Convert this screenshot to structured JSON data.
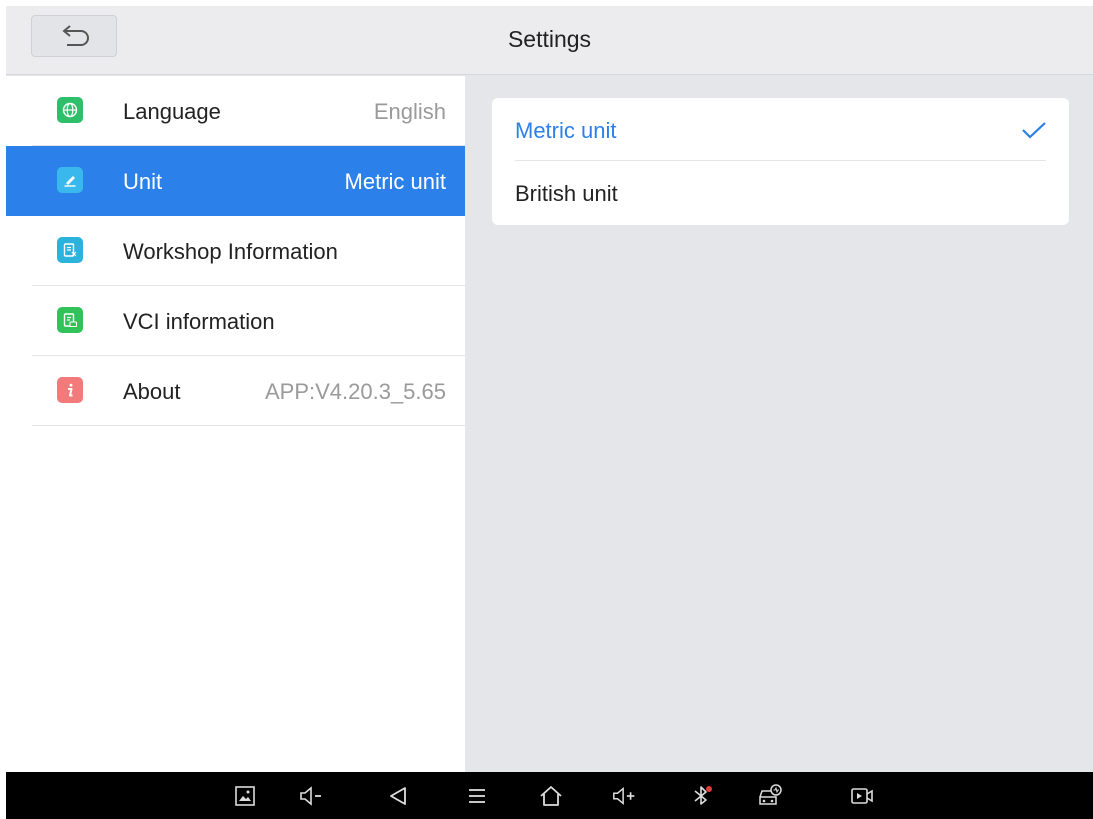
{
  "header": {
    "title": "Settings"
  },
  "sidebar": {
    "items": [
      {
        "label": "Language",
        "value": "English",
        "icon": "globe-icon",
        "color": "#2fbf6a"
      },
      {
        "label": "Unit",
        "value": "Metric unit",
        "icon": "ruler-pencil-icon",
        "color": "#39b8ee",
        "selected": true
      },
      {
        "label": "Workshop Information",
        "value": "",
        "icon": "document-edit-icon",
        "color": "#2bb3dc"
      },
      {
        "label": "VCI information",
        "value": "",
        "icon": "vci-document-icon",
        "color": "#33c25a"
      },
      {
        "label": "About",
        "value": "APP:V4.20.3_5.65",
        "icon": "info-icon",
        "color": "#f27a7a"
      }
    ]
  },
  "unit_options": {
    "items": [
      {
        "label": "Metric unit",
        "selected": true
      },
      {
        "label": "British unit",
        "selected": false
      }
    ]
  },
  "colors": {
    "accent": "#2b80ea",
    "background": "#e4e6e9"
  },
  "navbar": {
    "icons": [
      "screenshot-icon",
      "volume-down-icon",
      "back-triangle-icon",
      "menu-icon",
      "home-icon",
      "volume-up-icon",
      "bluetooth-icon",
      "vehicle-diagnostic-icon",
      "screen-record-icon"
    ]
  }
}
